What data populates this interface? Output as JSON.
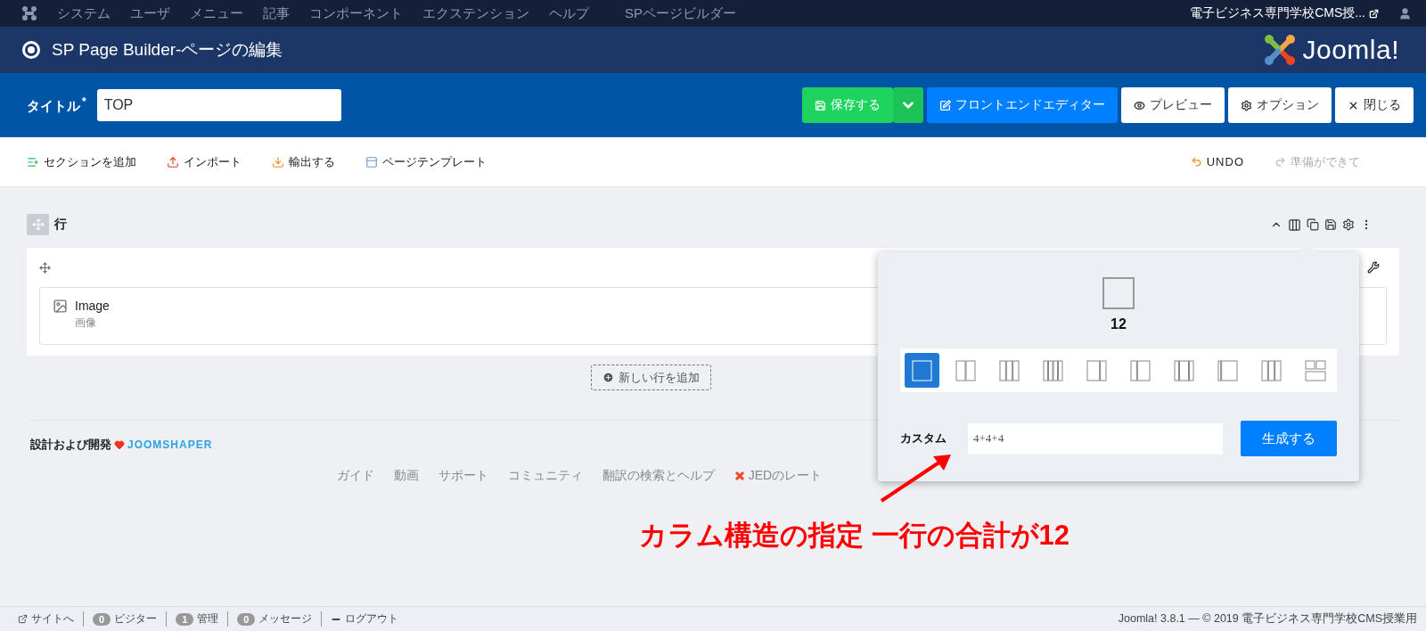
{
  "top_menu": {
    "items": [
      "システム",
      "ユーザ",
      "メニュー",
      "記事",
      "コンポーネント",
      "エクステンション",
      "ヘルプ",
      "SPページビルダー"
    ],
    "site_link": "電子ビジネス専門学校CMS授..."
  },
  "header": {
    "title": "SP Page Builder-ページの編集",
    "logo_text": "Joomla!"
  },
  "title_bar": {
    "label": "タイトル",
    "required_mark": "*",
    "value": "TOP",
    "buttons": [
      {
        "kind": "save",
        "label": "保存する"
      },
      {
        "kind": "dropdown"
      },
      {
        "kind": "primary",
        "label": "フロントエンドエディター"
      },
      {
        "kind": "preview",
        "label": "プレビュー"
      },
      {
        "kind": "options",
        "label": "オプション"
      },
      {
        "kind": "close",
        "label": "閉じる"
      }
    ]
  },
  "toolbar": {
    "items": [
      {
        "kind": "section",
        "label": "セクションを追加"
      },
      {
        "kind": "import",
        "label": "インポート"
      },
      {
        "kind": "export",
        "label": "輸出する"
      },
      {
        "kind": "template",
        "label": "ページテンプレート"
      }
    ],
    "undo": {
      "label": "UNDO",
      "disabled": false
    },
    "redo": {
      "label": "準備ができて",
      "disabled": true
    }
  },
  "row": {
    "label": "行",
    "addon": {
      "title": "Image",
      "subtitle": "画像"
    }
  },
  "add_row": "新しい行を追加",
  "footer": {
    "credit": "設計および開発",
    "brand": "JOOMSHAPER",
    "links": [
      "ガイド",
      "動画",
      "サポート",
      "コミュニティ",
      "翻訳の検索とヘルプ",
      "JEDのレート"
    ]
  },
  "popover": {
    "preview_number": "12",
    "layouts": [
      {
        "selected": true
      },
      {
        "selected": false
      },
      {
        "selected": false
      },
      {
        "selected": false
      },
      {
        "selected": false
      },
      {
        "selected": false
      },
      {
        "selected": false
      },
      {
        "selected": false
      },
      {
        "selected": false
      },
      {
        "selected": false
      }
    ],
    "custom_label": "カスタム",
    "custom_value": "4+4+4",
    "generate": "生成する"
  },
  "annotation": "カラム構造の指定 一行の合計が12",
  "status_bar": {
    "items": [
      {
        "kind": "link",
        "label": "サイトへ"
      },
      {
        "kind": "count",
        "count": "0",
        "label": "ビジター"
      },
      {
        "kind": "count",
        "count": "1",
        "label": "管理"
      },
      {
        "kind": "count",
        "count": "0",
        "label": "メッセージ"
      },
      {
        "kind": "logout",
        "label": "ログアウト"
      }
    ],
    "version": "Joomla! 3.8.1 — © 2019 電子ビジネス専門学校CMS授業用"
  }
}
